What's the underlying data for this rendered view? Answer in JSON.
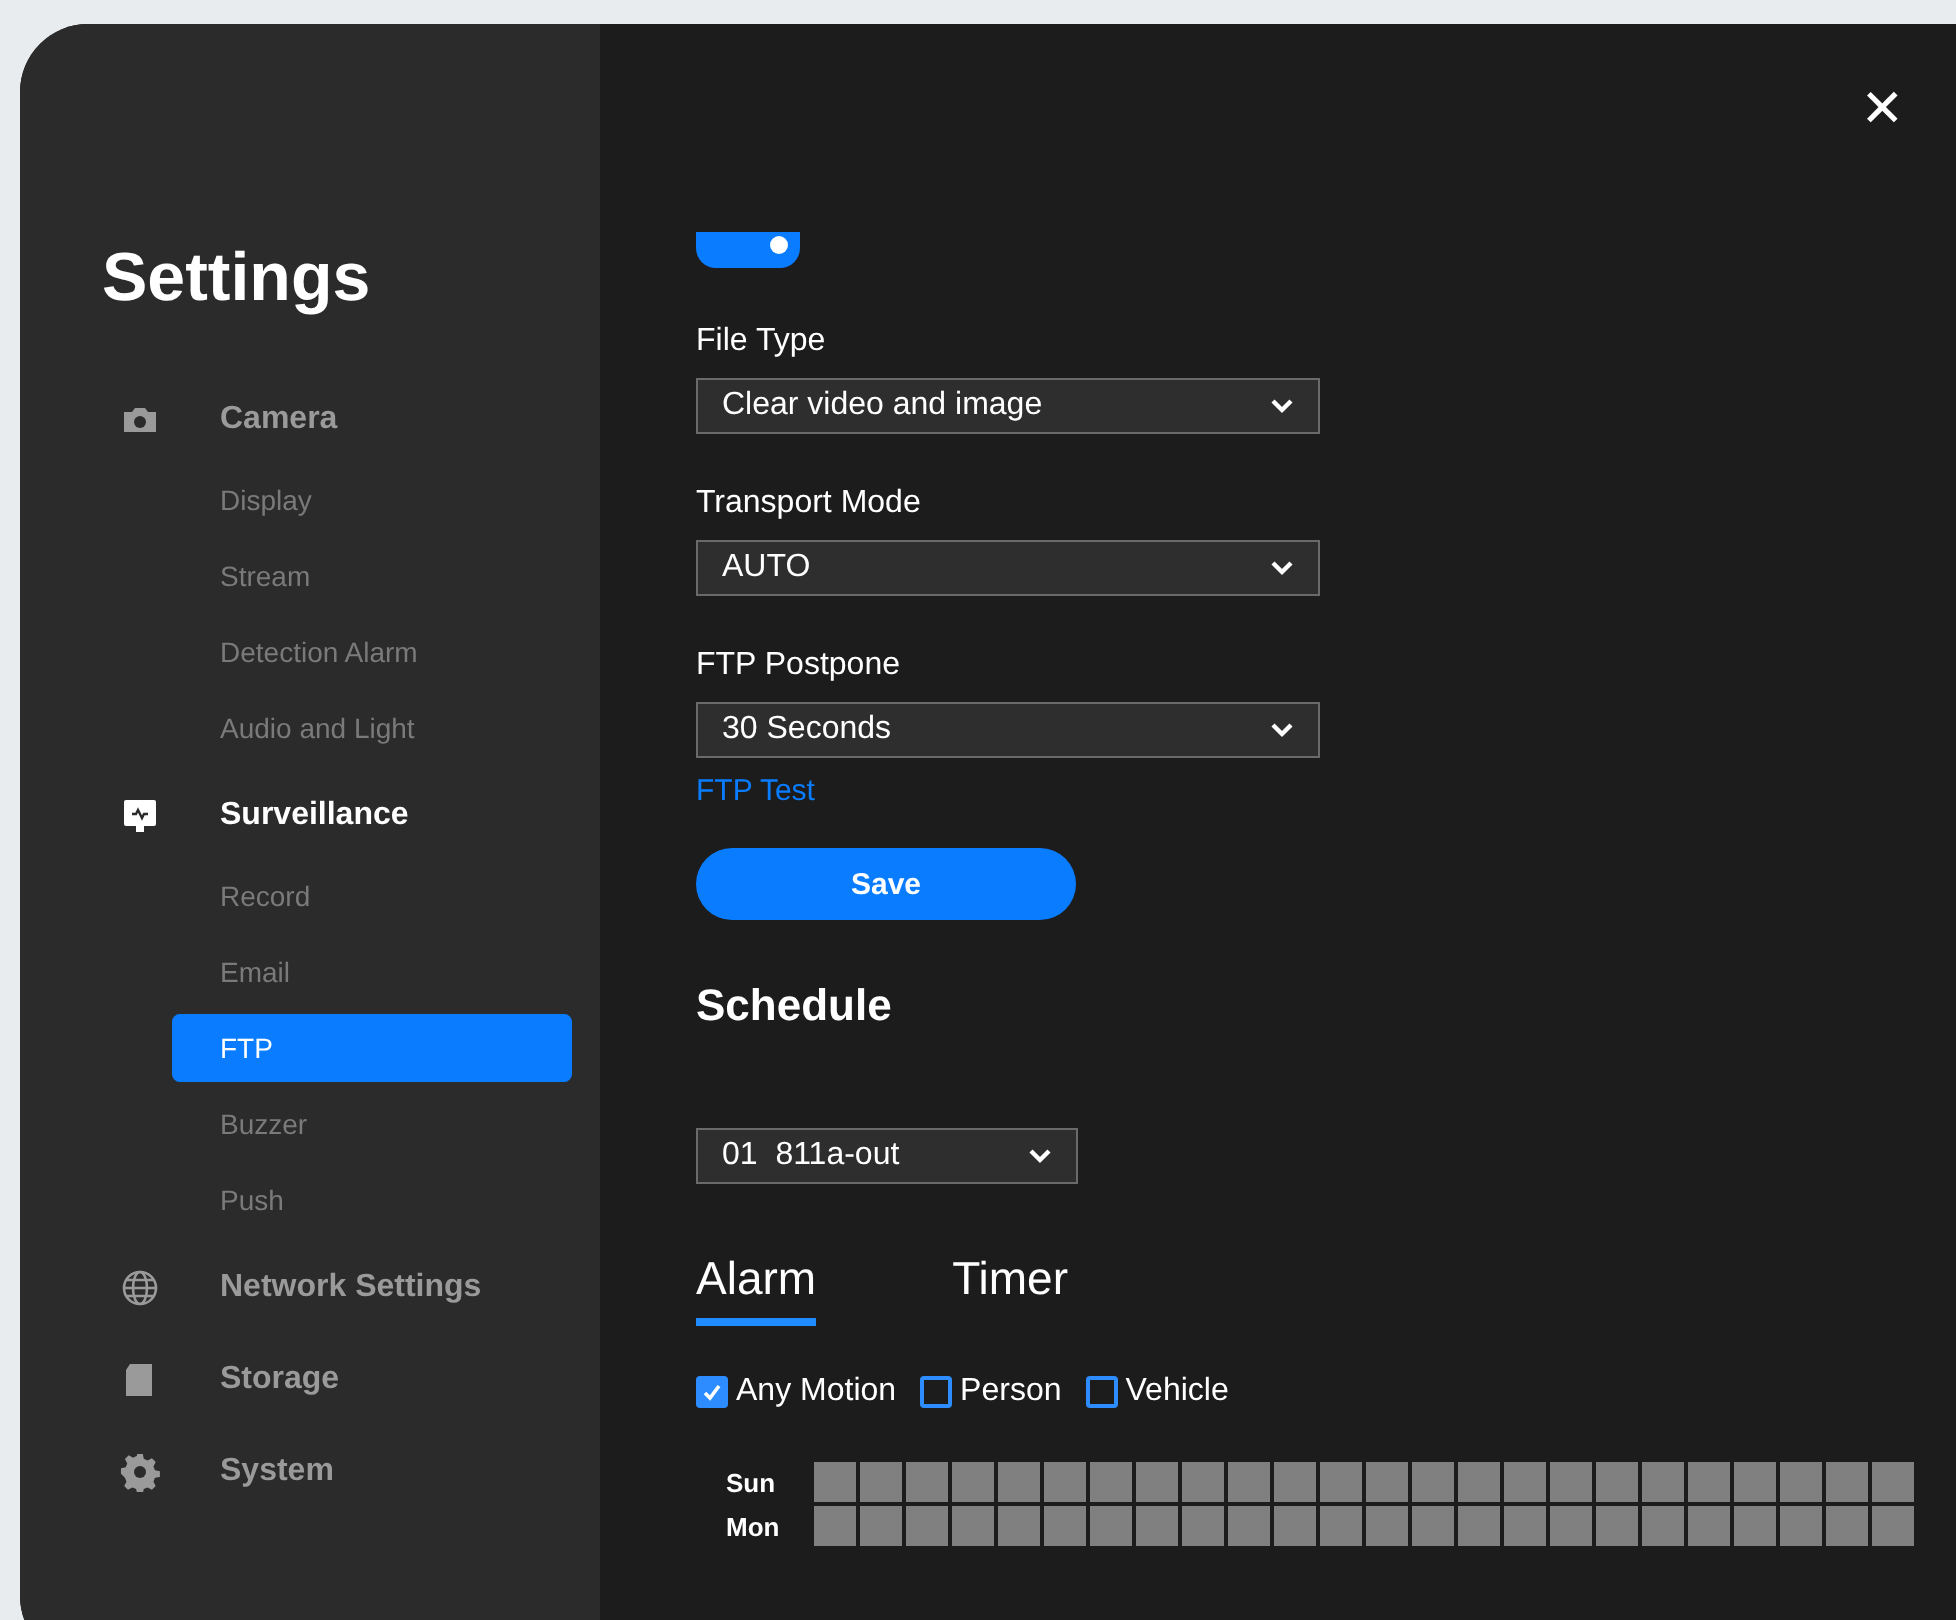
{
  "window": {
    "title": "Settings",
    "close": "✕"
  },
  "sidebar": {
    "groups": [
      {
        "label": "Camera",
        "kind": "camera",
        "selected": false,
        "items": [
          {
            "label": "Display",
            "selected": false
          },
          {
            "label": "Stream",
            "selected": false
          },
          {
            "label": "Detection Alarm",
            "selected": false
          },
          {
            "label": "Audio and Light",
            "selected": false
          }
        ]
      },
      {
        "label": "Surveillance",
        "kind": "monitor",
        "selected": true,
        "items": [
          {
            "label": "Record",
            "selected": false
          },
          {
            "label": "Email",
            "selected": false
          },
          {
            "label": "FTP",
            "selected": true
          },
          {
            "label": "Buzzer",
            "selected": false
          },
          {
            "label": "Push",
            "selected": false
          }
        ]
      },
      {
        "label": "Network Settings",
        "kind": "globe",
        "selected": false
      },
      {
        "label": "Storage",
        "kind": "card",
        "selected": false
      },
      {
        "label": "System",
        "kind": "gear",
        "selected": false
      }
    ]
  },
  "form": {
    "toggle": {
      "on": true
    },
    "fields": [
      {
        "label": "File Type",
        "value": "Clear video and image"
      },
      {
        "label": "Transport Mode",
        "value": "AUTO"
      },
      {
        "label": "FTP Postpone",
        "value": "30 Seconds"
      }
    ],
    "test_link": "FTP Test",
    "save": "Save"
  },
  "schedule": {
    "title": "Schedule",
    "channel": {
      "number": "01",
      "name": "811a-out"
    },
    "tabs": [
      {
        "label": "Alarm",
        "selected": true
      },
      {
        "label": "Timer",
        "selected": false
      }
    ],
    "checkboxes": [
      {
        "label": "Any Motion",
        "checked": true
      },
      {
        "label": "Person",
        "checked": false
      },
      {
        "label": "Vehicle",
        "checked": false
      }
    ],
    "days": [
      {
        "label": "Sun",
        "slots": [
          false,
          false,
          false,
          false,
          false,
          false,
          false,
          false,
          false,
          false,
          false,
          false,
          false,
          false,
          false,
          false,
          false,
          false,
          false,
          false,
          false,
          false,
          false,
          false
        ]
      },
      {
        "label": "Mon",
        "slots": [
          false,
          false,
          false,
          false,
          false,
          false,
          false,
          false,
          false,
          false,
          false,
          false,
          false,
          false,
          false,
          false,
          false,
          false,
          false,
          false,
          false,
          false,
          false,
          false
        ]
      }
    ]
  }
}
